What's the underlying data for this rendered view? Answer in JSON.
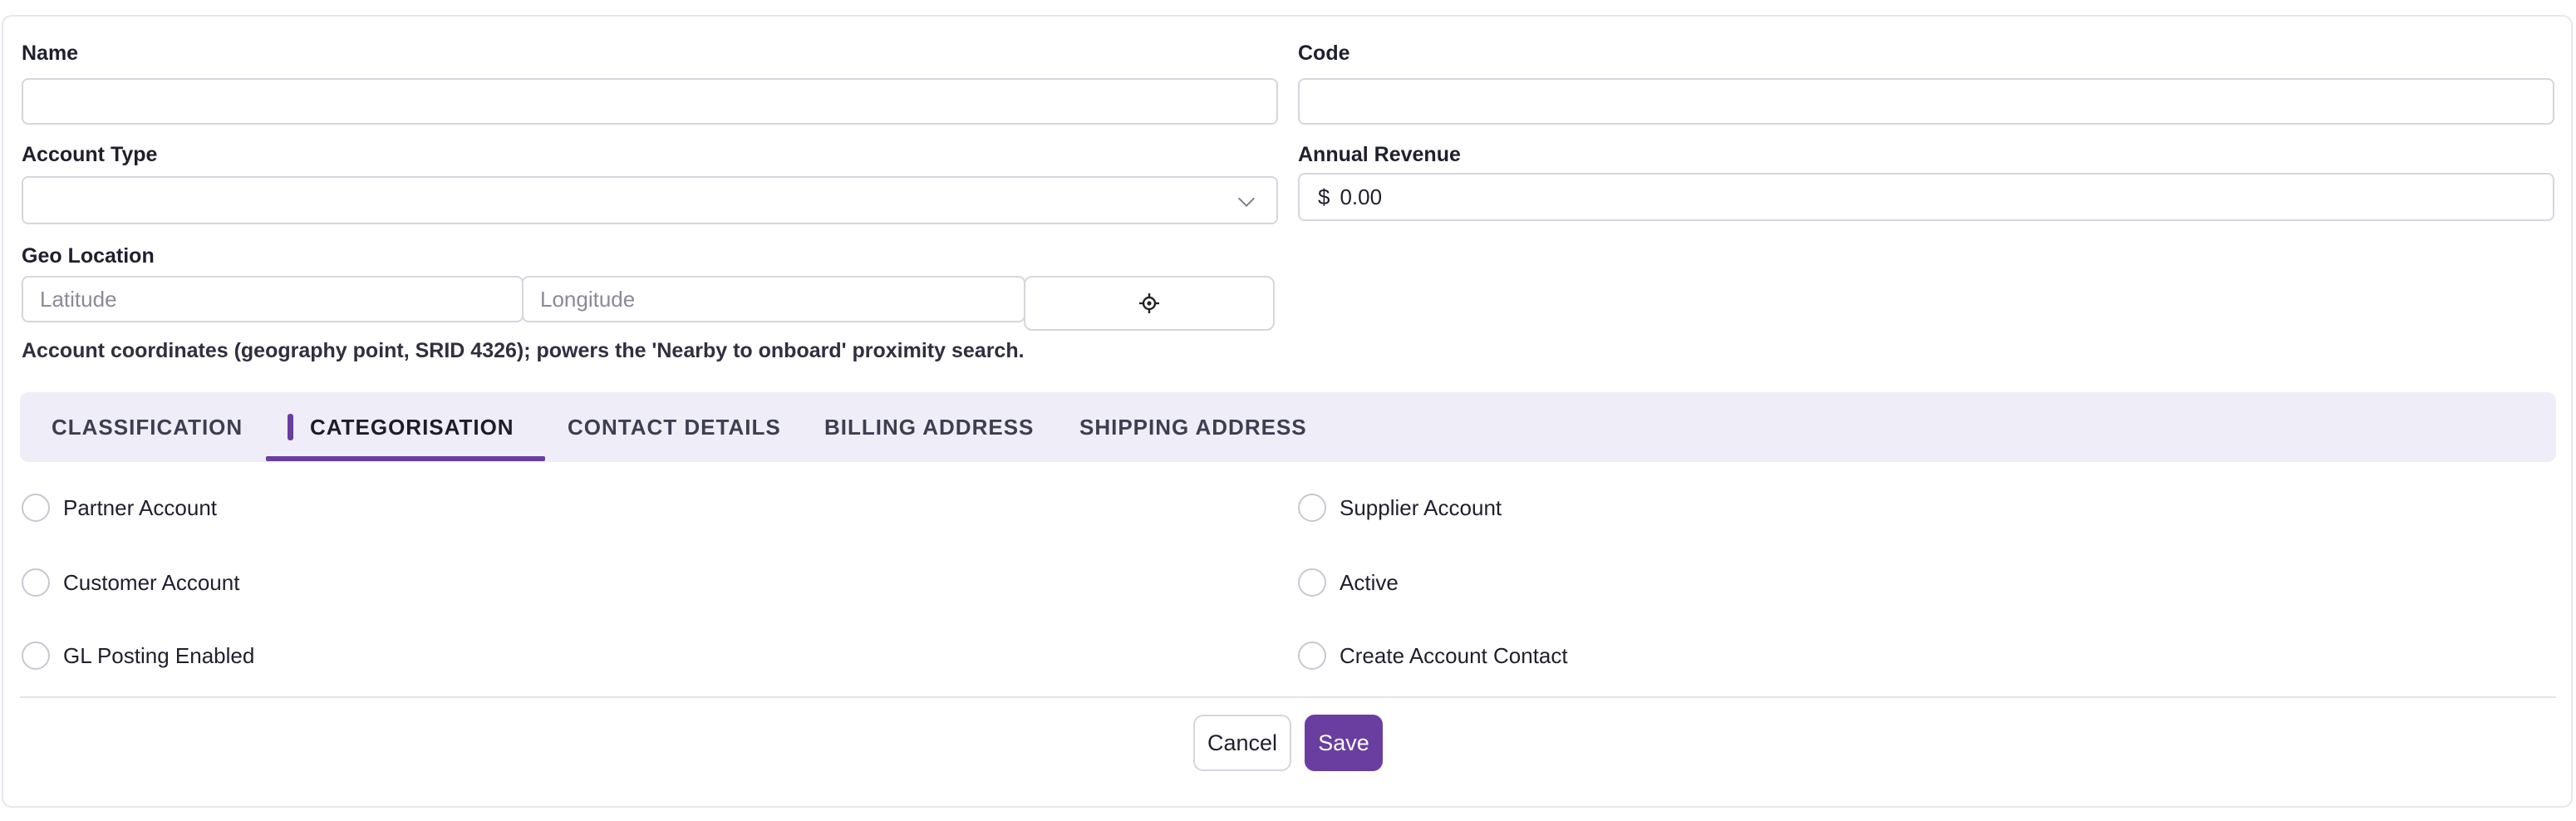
{
  "form": {
    "name": {
      "label": "Name",
      "value": ""
    },
    "code": {
      "label": "Code",
      "value": ""
    },
    "account_type": {
      "label": "Account Type",
      "value": ""
    },
    "annual_revenue": {
      "label": "Annual Revenue",
      "currency": "$",
      "value": "0.00"
    },
    "geo_location": {
      "label": "Geo Location",
      "latitude_placeholder": "Latitude",
      "longitude_placeholder": "Longitude",
      "help": "Account coordinates (geography point, SRID 4326); powers the 'Nearby to onboard' proximity search."
    }
  },
  "tabs": [
    {
      "label": "CLASSIFICATION",
      "active": false
    },
    {
      "label": "CATEGORISATION",
      "active": true
    },
    {
      "label": "CONTACT DETAILS",
      "active": false
    },
    {
      "label": "BILLING ADDRESS",
      "active": false
    },
    {
      "label": "SHIPPING ADDRESS",
      "active": false
    }
  ],
  "checkboxes": {
    "left": [
      {
        "label": "Partner Account",
        "checked": false
      },
      {
        "label": "Customer Account",
        "checked": false
      },
      {
        "label": "GL Posting Enabled",
        "checked": false
      }
    ],
    "right": [
      {
        "label": "Supplier Account",
        "checked": false
      },
      {
        "label": "Active",
        "checked": false
      },
      {
        "label": "Create Account Contact",
        "checked": false
      }
    ]
  },
  "actions": {
    "cancel_label": "Cancel",
    "save_label": "Save"
  },
  "icons": {
    "locate": "crosshair-icon",
    "dropdown": "chevron-down-icon"
  },
  "colors": {
    "accent": "#6a3ea0",
    "tab_bar_bg": "#efedf7",
    "border": "#d6d6de"
  }
}
